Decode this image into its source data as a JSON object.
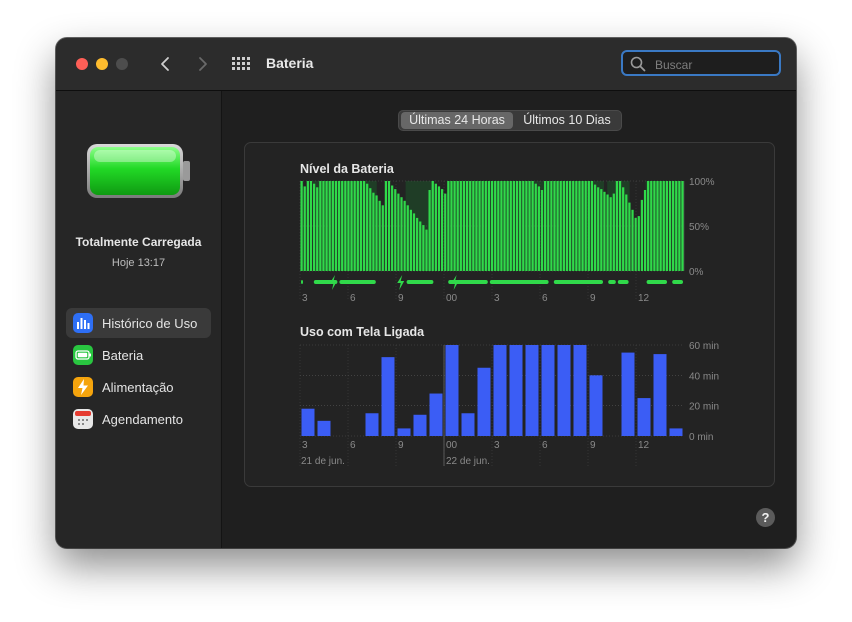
{
  "window": {
    "title": "Bateria",
    "search": {
      "placeholder": "Buscar",
      "value": ""
    },
    "help_label": "?"
  },
  "icons": {
    "close": "close-traffic-light",
    "minimize": "minimize-traffic-light",
    "zoom": "zoom-traffic-light",
    "back": "chevron-left-icon",
    "forward": "chevron-right-icon",
    "show_all": "grid-icon",
    "search": "search-icon",
    "battery": "battery-icon",
    "charging": "charging-bolt-icon"
  },
  "sidebar": {
    "battery_status": "Totalmente Carregada",
    "battery_time": "Hoje 13:17",
    "items": [
      {
        "label": "Histórico de Uso",
        "icon": "bar-chart-icon",
        "color": "#2e6ff5",
        "active": true
      },
      {
        "label": "Bateria",
        "icon": "battery-icon",
        "color": "#29c640",
        "active": false
      },
      {
        "label": "Alimentação",
        "icon": "lightning-icon",
        "color": "#f5a40d",
        "active": false
      },
      {
        "label": "Agendamento",
        "icon": "calendar-icon",
        "color": "#e8e8e8",
        "active": false
      }
    ]
  },
  "segmented": {
    "options": [
      "Últimas 24 Horas",
      "Últimos 10 Dias"
    ],
    "selected": 0
  },
  "colors": {
    "battery_bar": "#30d94a",
    "charging_bar": "#30d94a",
    "screen_bar": "#3b5df5",
    "charging_bg": "#1f3d26"
  },
  "chart_data": [
    {
      "type": "bar",
      "title": "Nível da Bateria",
      "x_tick_labels": [
        "3",
        "6",
        "9",
        "00",
        "3",
        "6",
        "9",
        "12"
      ],
      "date_labels": [],
      "y_tick_labels": [
        "100%",
        "50%",
        "0%"
      ],
      "ylim": [
        0,
        100
      ],
      "grid": true,
      "unit": "%",
      "values": [
        100,
        94,
        100,
        100,
        97,
        93,
        100,
        100,
        100,
        100,
        100,
        100,
        100,
        100,
        100,
        100,
        100,
        100,
        100,
        100,
        100,
        97,
        92,
        87,
        84,
        78,
        73,
        100,
        100,
        95,
        91,
        86,
        82,
        78,
        73,
        68,
        64,
        59,
        55,
        51,
        46,
        90,
        100,
        97,
        94,
        91,
        86,
        100,
        100,
        100,
        100,
        100,
        100,
        100,
        100,
        100,
        100,
        100,
        100,
        100,
        100,
        100,
        100,
        100,
        100,
        100,
        100,
        100,
        100,
        100,
        100,
        100,
        100,
        100,
        100,
        97,
        94,
        90,
        100,
        100,
        100,
        100,
        100,
        100,
        100,
        100,
        100,
        100,
        100,
        100,
        100,
        100,
        100,
        100,
        96,
        93,
        91,
        88,
        85,
        82,
        86,
        100,
        100,
        93,
        85,
        76,
        68,
        59,
        61,
        79,
        90,
        100,
        100,
        100,
        100,
        100,
        100,
        100,
        100,
        100,
        100,
        100,
        100
      ],
      "charging_segments": [
        [
          0,
          1
        ],
        [
          4,
          12
        ],
        [
          12,
          24
        ],
        [
          33,
          42
        ],
        [
          46,
          59
        ],
        [
          59,
          78
        ],
        [
          79,
          95
        ],
        [
          96,
          99
        ],
        [
          99,
          103
        ],
        [
          108,
          115
        ],
        [
          116,
          120
        ]
      ],
      "charging_bolts": [
        10,
        31,
        48
      ]
    },
    {
      "type": "bar",
      "title": "Uso com Tela Ligada",
      "x_tick_labels": [
        "3",
        "6",
        "9",
        "00",
        "3",
        "6",
        "9",
        "12"
      ],
      "date_labels": [
        "21 de jun.",
        "22 de jun."
      ],
      "y_tick_labels": [
        "60 min",
        "40 min",
        "20 min",
        "0 min"
      ],
      "ylim": [
        0,
        60
      ],
      "grid": true,
      "unit": "min",
      "values": [
        18,
        10,
        0,
        0,
        15,
        52,
        5,
        14,
        28,
        60,
        15,
        45,
        60,
        60,
        60,
        60,
        60,
        60,
        40,
        0,
        55,
        25,
        54,
        5
      ]
    }
  ]
}
